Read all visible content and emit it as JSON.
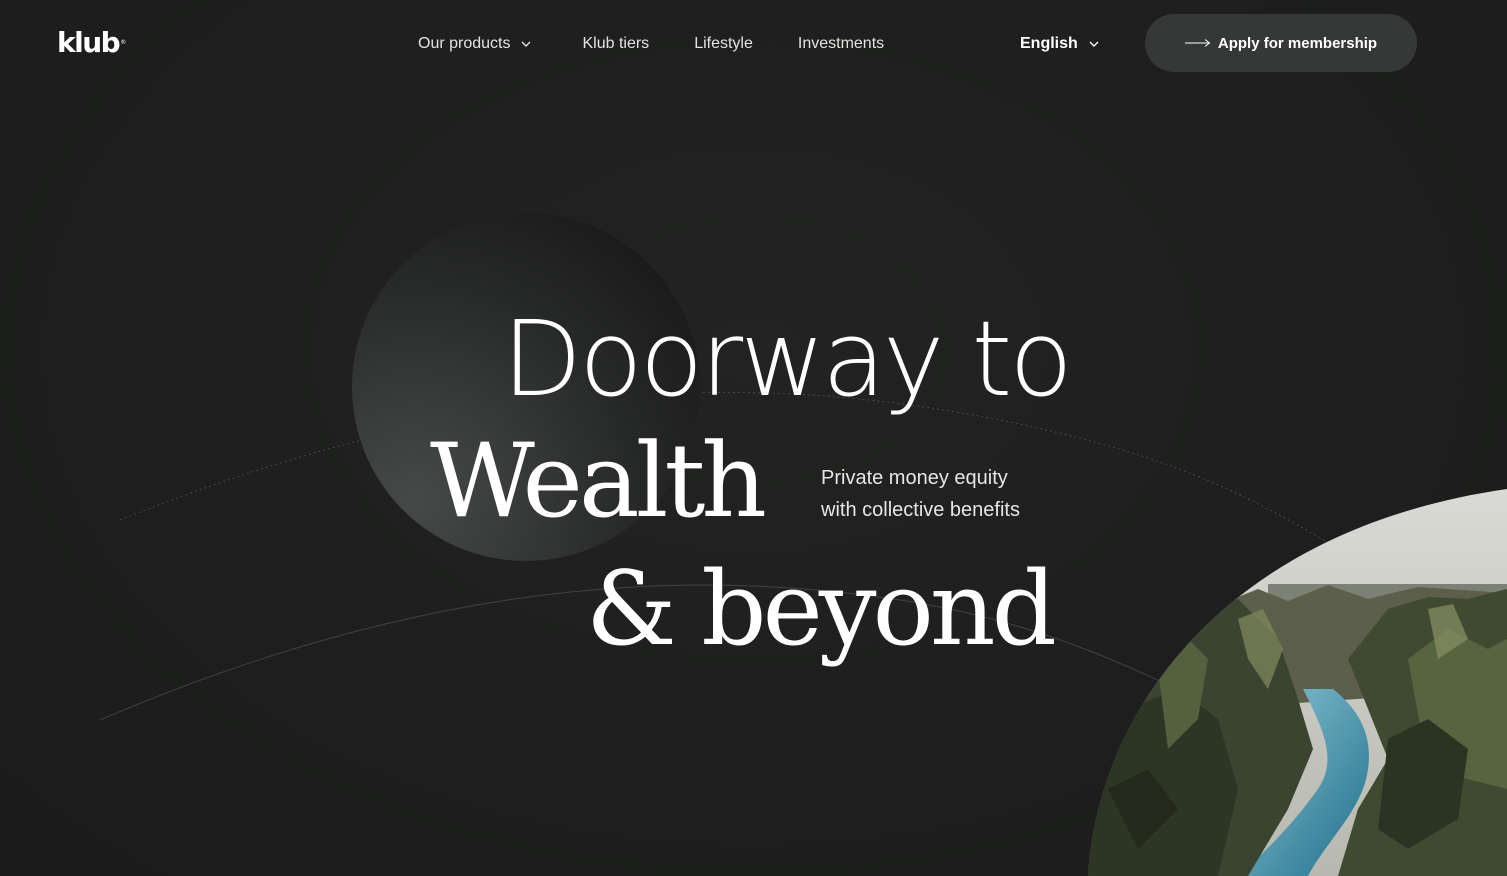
{
  "brand": {
    "logo_text": "klub",
    "logo_mark": "®"
  },
  "nav": {
    "items": [
      {
        "label": "Our products",
        "has_dropdown": true
      },
      {
        "label": "Klub tiers"
      },
      {
        "label": "Lifestyle"
      },
      {
        "label": "Investments"
      }
    ]
  },
  "language": {
    "selected": "English"
  },
  "cta": {
    "label": "Apply for membership",
    "icon": "arrow-right-icon"
  },
  "hero": {
    "line1": "Doorway to",
    "line2": "Wealth",
    "line3": "& beyond",
    "tagline_line1": "Private money equity",
    "tagline_line2": "with collective benefits"
  },
  "colors": {
    "background": "#1d1e1d",
    "button_bg": "#353837",
    "text": "#ffffff"
  },
  "icons": {
    "chevron": "chevron-down-icon",
    "arrow": "arrow-right-icon"
  }
}
